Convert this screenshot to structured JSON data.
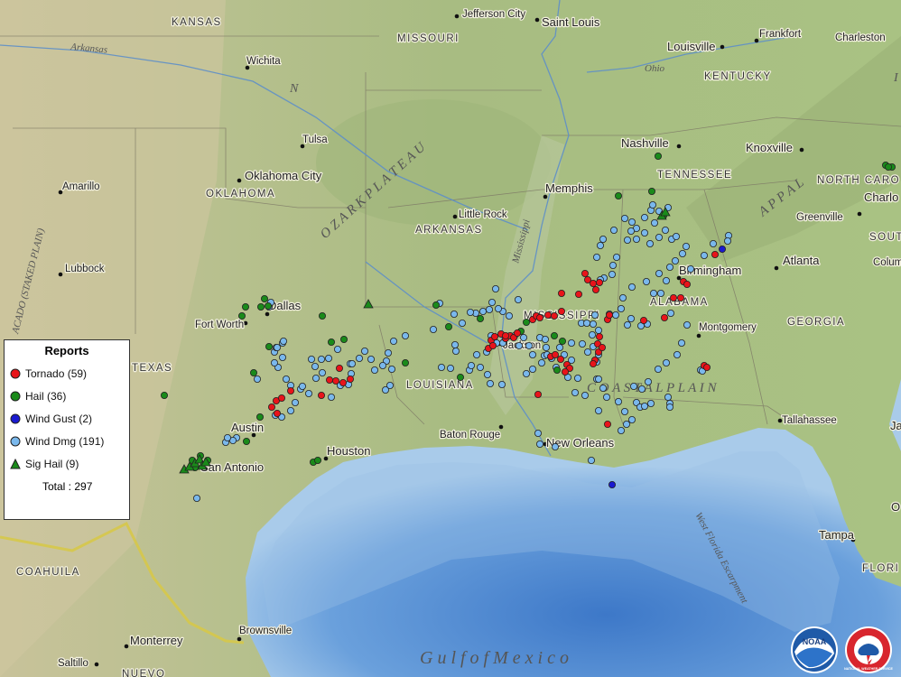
{
  "legend": {
    "title": "Reports",
    "items": [
      {
        "label": "Tornado (59)",
        "color": "#e8141a",
        "shape": "circle"
      },
      {
        "label": "Hail (36)",
        "color": "#1a8a1a",
        "shape": "circle"
      },
      {
        "label": "Wind Gust (2)",
        "color": "#1a1ad0",
        "shape": "circle"
      },
      {
        "label": "Wind Dmg (191)",
        "color": "#7ab8ec",
        "shape": "circle"
      },
      {
        "label": "Sig Hail (9)",
        "color": "#1a8a1a",
        "shape": "triangle"
      }
    ],
    "total": "Total : 297"
  },
  "labels": {
    "states": {
      "kansas": "KANSAS",
      "missouri": "MISSOURI",
      "kentucky": "KENTUCKY",
      "tennessee": "TENNESSEE",
      "north_carolina": "NORTH CARO",
      "south": "SOUT",
      "oklahoma": "OKLAHOMA",
      "arkansas": "ARKANSAS",
      "mississippi": "MISSISSIPPI",
      "alabama": "ALABAMA",
      "georgia": "GEORGIA",
      "texas": "TEXAS",
      "louisiana": "LOUISIANA",
      "florida": "FLORI",
      "coahuila": "COAHUILA",
      "nuevo": "NUEVO"
    },
    "cities": {
      "wichita": "Wichita",
      "jefferson_city": "Jefferson City",
      "saint_louis": "Saint Louis",
      "louisville": "Louisville",
      "frankfort": "Frankfort",
      "charleston": "Charleston",
      "tulsa": "Tulsa",
      "oklahoma_city": "Oklahoma City",
      "amarillo": "Amarillo",
      "lubbock": "Lubbock",
      "nashville": "Nashville",
      "knoxville": "Knoxville",
      "memphis": "Memphis",
      "little_rock": "Little Rock",
      "charlo": "Charlo",
      "greenville": "Greenville",
      "birmingham": "Birmingham",
      "atlanta": "Atlanta",
      "colum": "Colum",
      "dallas": "Dallas",
      "fort_worth": "Fort Worth",
      "jackson": "Jackson",
      "montgomery": "Montgomery",
      "austin": "Austin",
      "houston": "Houston",
      "san_antonio": "San Antonio",
      "baton_rouge": "Baton Rouge",
      "new_orleans": "New Orleans",
      "tallahassee": "Tallahassee",
      "ja": "Ja",
      "tampa": "Tampa",
      "brownsville": "Brownsville",
      "monterrey": "Monterrey",
      "saltillo": "Saltillo",
      "o": "O"
    },
    "physical": {
      "arkansas_river": "Arkansas",
      "ohio_river": "Ohio",
      "mississippi_river": "Mississippi",
      "ozark_plateau": "O Z A R K   P L A T E A U",
      "llano": "ACADO (STAKED PLAIN)",
      "coastal_plain": "C O A S T A L   P L A I N",
      "appalachian": "A P P A L",
      "gulf": "G u l f   o f   M e x i c o",
      "escarpment": "West Florida Escarpment",
      "n_mark": "N",
      "i_mark": "I"
    },
    "logos": {
      "noaa": "NOAA",
      "nws": "NATIONAL WEATHER SERVICE"
    }
  },
  "reports": {
    "tornado": [
      [
        648,
        303
      ],
      [
        651,
        310
      ],
      [
        657,
        314
      ],
      [
        660,
        321
      ],
      [
        664,
        313
      ],
      [
        622,
        325
      ],
      [
        641,
        326
      ],
      [
        607,
        349
      ],
      [
        614,
        350
      ],
      [
        622,
        345
      ],
      [
        590,
        354
      ],
      [
        594,
        350
      ],
      [
        598,
        352
      ],
      [
        555,
        370
      ],
      [
        560,
        375
      ],
      [
        565,
        372
      ],
      [
        569,
        374
      ],
      [
        573,
        369
      ],
      [
        544,
        377
      ],
      [
        541,
        386
      ],
      [
        546,
        383
      ],
      [
        548,
        373
      ],
      [
        560,
        372
      ],
      [
        664,
        373
      ],
      [
        662,
        381
      ],
      [
        663,
        390
      ],
      [
        659,
        399
      ],
      [
        657,
        403
      ],
      [
        667,
        385
      ],
      [
        628,
        404
      ],
      [
        631,
        408
      ],
      [
        626,
        412
      ],
      [
        610,
        395
      ],
      [
        615,
        393
      ],
      [
        621,
        398
      ],
      [
        673,
        354
      ],
      [
        675,
        349
      ],
      [
        596,
        437
      ],
      [
        673,
        470
      ],
      [
        713,
        355
      ],
      [
        736,
        352
      ],
      [
        746,
        330
      ],
      [
        754,
        330
      ],
      [
        757,
        312
      ],
      [
        761,
        315
      ],
      [
        792,
        282
      ],
      [
        780,
        405
      ],
      [
        783,
        407
      ],
      [
        372,
        422
      ],
      [
        380,
        424
      ],
      [
        388,
        420
      ],
      [
        365,
        421
      ],
      [
        376,
        408
      ],
      [
        356,
        438
      ],
      [
        306,
        444
      ],
      [
        312,
        441
      ],
      [
        322,
        433
      ],
      [
        307,
        458
      ],
      [
        301,
        451
      ]
    ],
    "hail": [
      [
        729,
        173
      ],
      [
        722,
        212
      ],
      [
        685,
        217
      ],
      [
        293,
        331
      ],
      [
        297,
        339
      ],
      [
        289,
        340
      ],
      [
        272,
        340
      ],
      [
        268,
        350
      ],
      [
        357,
        350
      ],
      [
        367,
        379
      ],
      [
        298,
        384
      ],
      [
        281,
        413
      ],
      [
        182,
        438
      ],
      [
        288,
        462
      ],
      [
        273,
        489
      ],
      [
        222,
        505
      ],
      [
        213,
        510
      ],
      [
        216,
        518
      ],
      [
        230,
        510
      ],
      [
        347,
        512
      ],
      [
        352,
        510
      ],
      [
        381,
        376
      ],
      [
        497,
        362
      ],
      [
        532,
        353
      ],
      [
        483,
        338
      ],
      [
        449,
        402
      ],
      [
        510,
        418
      ],
      [
        577,
        367
      ],
      [
        583,
        357
      ],
      [
        623,
        378
      ],
      [
        617,
        410
      ],
      [
        614,
        372
      ],
      [
        735,
        239
      ],
      [
        981,
        183
      ],
      [
        988,
        185
      ],
      [
        984,
        185
      ]
    ],
    "windgust": [
      [
        800,
        276
      ],
      [
        678,
        537
      ]
    ],
    "winddmg": [
      [
        692,
        242
      ],
      [
        700,
        246
      ],
      [
        705,
        253
      ],
      [
        714,
        241
      ],
      [
        721,
        233
      ],
      [
        730,
        234
      ],
      [
        723,
        227
      ],
      [
        695,
        266
      ],
      [
        714,
        258
      ],
      [
        699,
        256
      ],
      [
        725,
        247
      ],
      [
        737,
        255
      ],
      [
        744,
        265
      ],
      [
        749,
        262
      ],
      [
        740,
        230
      ],
      [
        807,
        261
      ],
      [
        806,
        267
      ],
      [
        683,
        285
      ],
      [
        679,
        294
      ],
      [
        678,
        304
      ],
      [
        669,
        308
      ],
      [
        665,
        310
      ],
      [
        665,
        272
      ],
      [
        661,
        285
      ],
      [
        675,
        348
      ],
      [
        682,
        349
      ],
      [
        717,
        359
      ],
      [
        699,
        353
      ],
      [
        695,
        360
      ],
      [
        710,
        361
      ],
      [
        659,
        349
      ],
      [
        657,
        359
      ],
      [
        663,
        366
      ],
      [
        644,
        358
      ],
      [
        650,
        358
      ],
      [
        656,
        371
      ],
      [
        663,
        393
      ],
      [
        661,
        401
      ],
      [
        661,
        420
      ],
      [
        663,
        455
      ],
      [
        648,
        438
      ],
      [
        633,
        399
      ],
      [
        640,
        419
      ],
      [
        637,
        435
      ],
      [
        629,
        418
      ],
      [
        616,
        407
      ],
      [
        611,
        397
      ],
      [
        598,
        374
      ],
      [
        604,
        376
      ],
      [
        605,
        385
      ],
      [
        603,
        394
      ],
      [
        590,
        393
      ],
      [
        586,
        383
      ],
      [
        580,
        374
      ],
      [
        575,
        383
      ],
      [
        570,
        372
      ],
      [
        574,
        332
      ],
      [
        564,
        350
      ],
      [
        557,
        345
      ],
      [
        552,
        342
      ],
      [
        549,
        320
      ],
      [
        545,
        335
      ],
      [
        542,
        343
      ],
      [
        535,
        345
      ],
      [
        527,
        347
      ],
      [
        521,
        346
      ],
      [
        512,
        358
      ],
      [
        504,
        382
      ],
      [
        505,
        389
      ],
      [
        520,
        410
      ],
      [
        499,
        408
      ],
      [
        489,
        407
      ],
      [
        480,
        365
      ],
      [
        487,
        336
      ],
      [
        503,
        348
      ],
      [
        449,
        372
      ],
      [
        436,
        378
      ],
      [
        430,
        391
      ],
      [
        428,
        400
      ],
      [
        424,
        405
      ],
      [
        434,
        409
      ],
      [
        432,
        427
      ],
      [
        427,
        432
      ],
      [
        411,
        398
      ],
      [
        415,
        410
      ],
      [
        404,
        389
      ],
      [
        398,
        397
      ],
      [
        388,
        403
      ],
      [
        374,
        387
      ],
      [
        364,
        397
      ],
      [
        356,
        398
      ],
      [
        349,
        406
      ],
      [
        345,
        398
      ],
      [
        350,
        419
      ],
      [
        357,
        413
      ],
      [
        377,
        427
      ],
      [
        386,
        426
      ],
      [
        389,
        414
      ],
      [
        390,
        403
      ],
      [
        367,
        440
      ],
      [
        342,
        436
      ],
      [
        333,
        431
      ],
      [
        322,
        427
      ],
      [
        317,
        420
      ],
      [
        308,
        407
      ],
      [
        313,
        396
      ],
      [
        304,
        402
      ],
      [
        304,
        390
      ],
      [
        306,
        385
      ],
      [
        313,
        380
      ],
      [
        314,
        378
      ],
      [
        307,
        385
      ],
      [
        285,
        420
      ],
      [
        262,
        485
      ],
      [
        258,
        488
      ],
      [
        250,
        490
      ],
      [
        252,
        485
      ],
      [
        218,
        552
      ],
      [
        305,
        460
      ],
      [
        312,
        462
      ],
      [
        335,
        428
      ],
      [
        327,
        446
      ],
      [
        322,
        455
      ],
      [
        298,
        340
      ],
      [
        300,
        335
      ],
      [
        596,
        480
      ],
      [
        598,
        492
      ],
      [
        615,
        495
      ],
      [
        655,
        510
      ],
      [
        740,
        440
      ],
      [
        742,
        447
      ],
      [
        742,
        451
      ],
      [
        721,
        447
      ],
      [
        702,
        428
      ],
      [
        705,
        446
      ],
      [
        709,
        451
      ],
      [
        714,
        450
      ],
      [
        776,
        410
      ],
      [
        778,
        411
      ],
      [
        544,
        372
      ],
      [
        550,
        380
      ],
      [
        557,
        380
      ],
      [
        539,
        390
      ],
      [
        528,
        393
      ],
      [
        522,
        405
      ],
      [
        532,
        407
      ],
      [
        540,
        415
      ],
      [
        543,
        425
      ],
      [
        556,
        426
      ],
      [
        583,
        414
      ],
      [
        590,
        409
      ],
      [
        600,
        402
      ],
      [
        606,
        393
      ],
      [
        620,
        385
      ],
      [
        625,
        393
      ],
      [
        633,
        380
      ],
      [
        645,
        381
      ],
      [
        651,
        390
      ],
      [
        657,
        384
      ],
      [
        663,
        420
      ],
      [
        668,
        430
      ],
      [
        672,
        440
      ],
      [
        685,
        445
      ],
      [
        692,
        456
      ],
      [
        694,
        470
      ],
      [
        688,
        477
      ],
      [
        700,
        465
      ],
      [
        711,
        431
      ],
      [
        718,
        423
      ],
      [
        729,
        409
      ],
      [
        738,
        402
      ],
      [
        750,
        393
      ],
      [
        755,
        380
      ],
      [
        761,
        360
      ],
      [
        743,
        347
      ],
      [
        732,
        325
      ],
      [
        724,
        325
      ],
      [
        738,
        311
      ],
      [
        765,
        298
      ],
      [
        780,
        283
      ],
      [
        790,
        270
      ],
      [
        668,
        265
      ],
      [
        680,
        255
      ],
      [
        705,
        265
      ],
      [
        720,
        270
      ],
      [
        730,
        263
      ],
      [
        760,
        273
      ],
      [
        756,
        281
      ],
      [
        748,
        289
      ],
      [
        742,
        296
      ],
      [
        730,
        303
      ],
      [
        716,
        312
      ],
      [
        700,
        318
      ],
      [
        690,
        330
      ],
      [
        688,
        342
      ]
    ],
    "sighail": [
      [
        408,
        337
      ],
      [
        204,
        520
      ],
      [
        210,
        517
      ],
      [
        216,
        513
      ],
      [
        221,
        509
      ],
      [
        224,
        516
      ],
      [
        228,
        512
      ],
      [
        733,
        239
      ],
      [
        737,
        235
      ]
    ]
  }
}
